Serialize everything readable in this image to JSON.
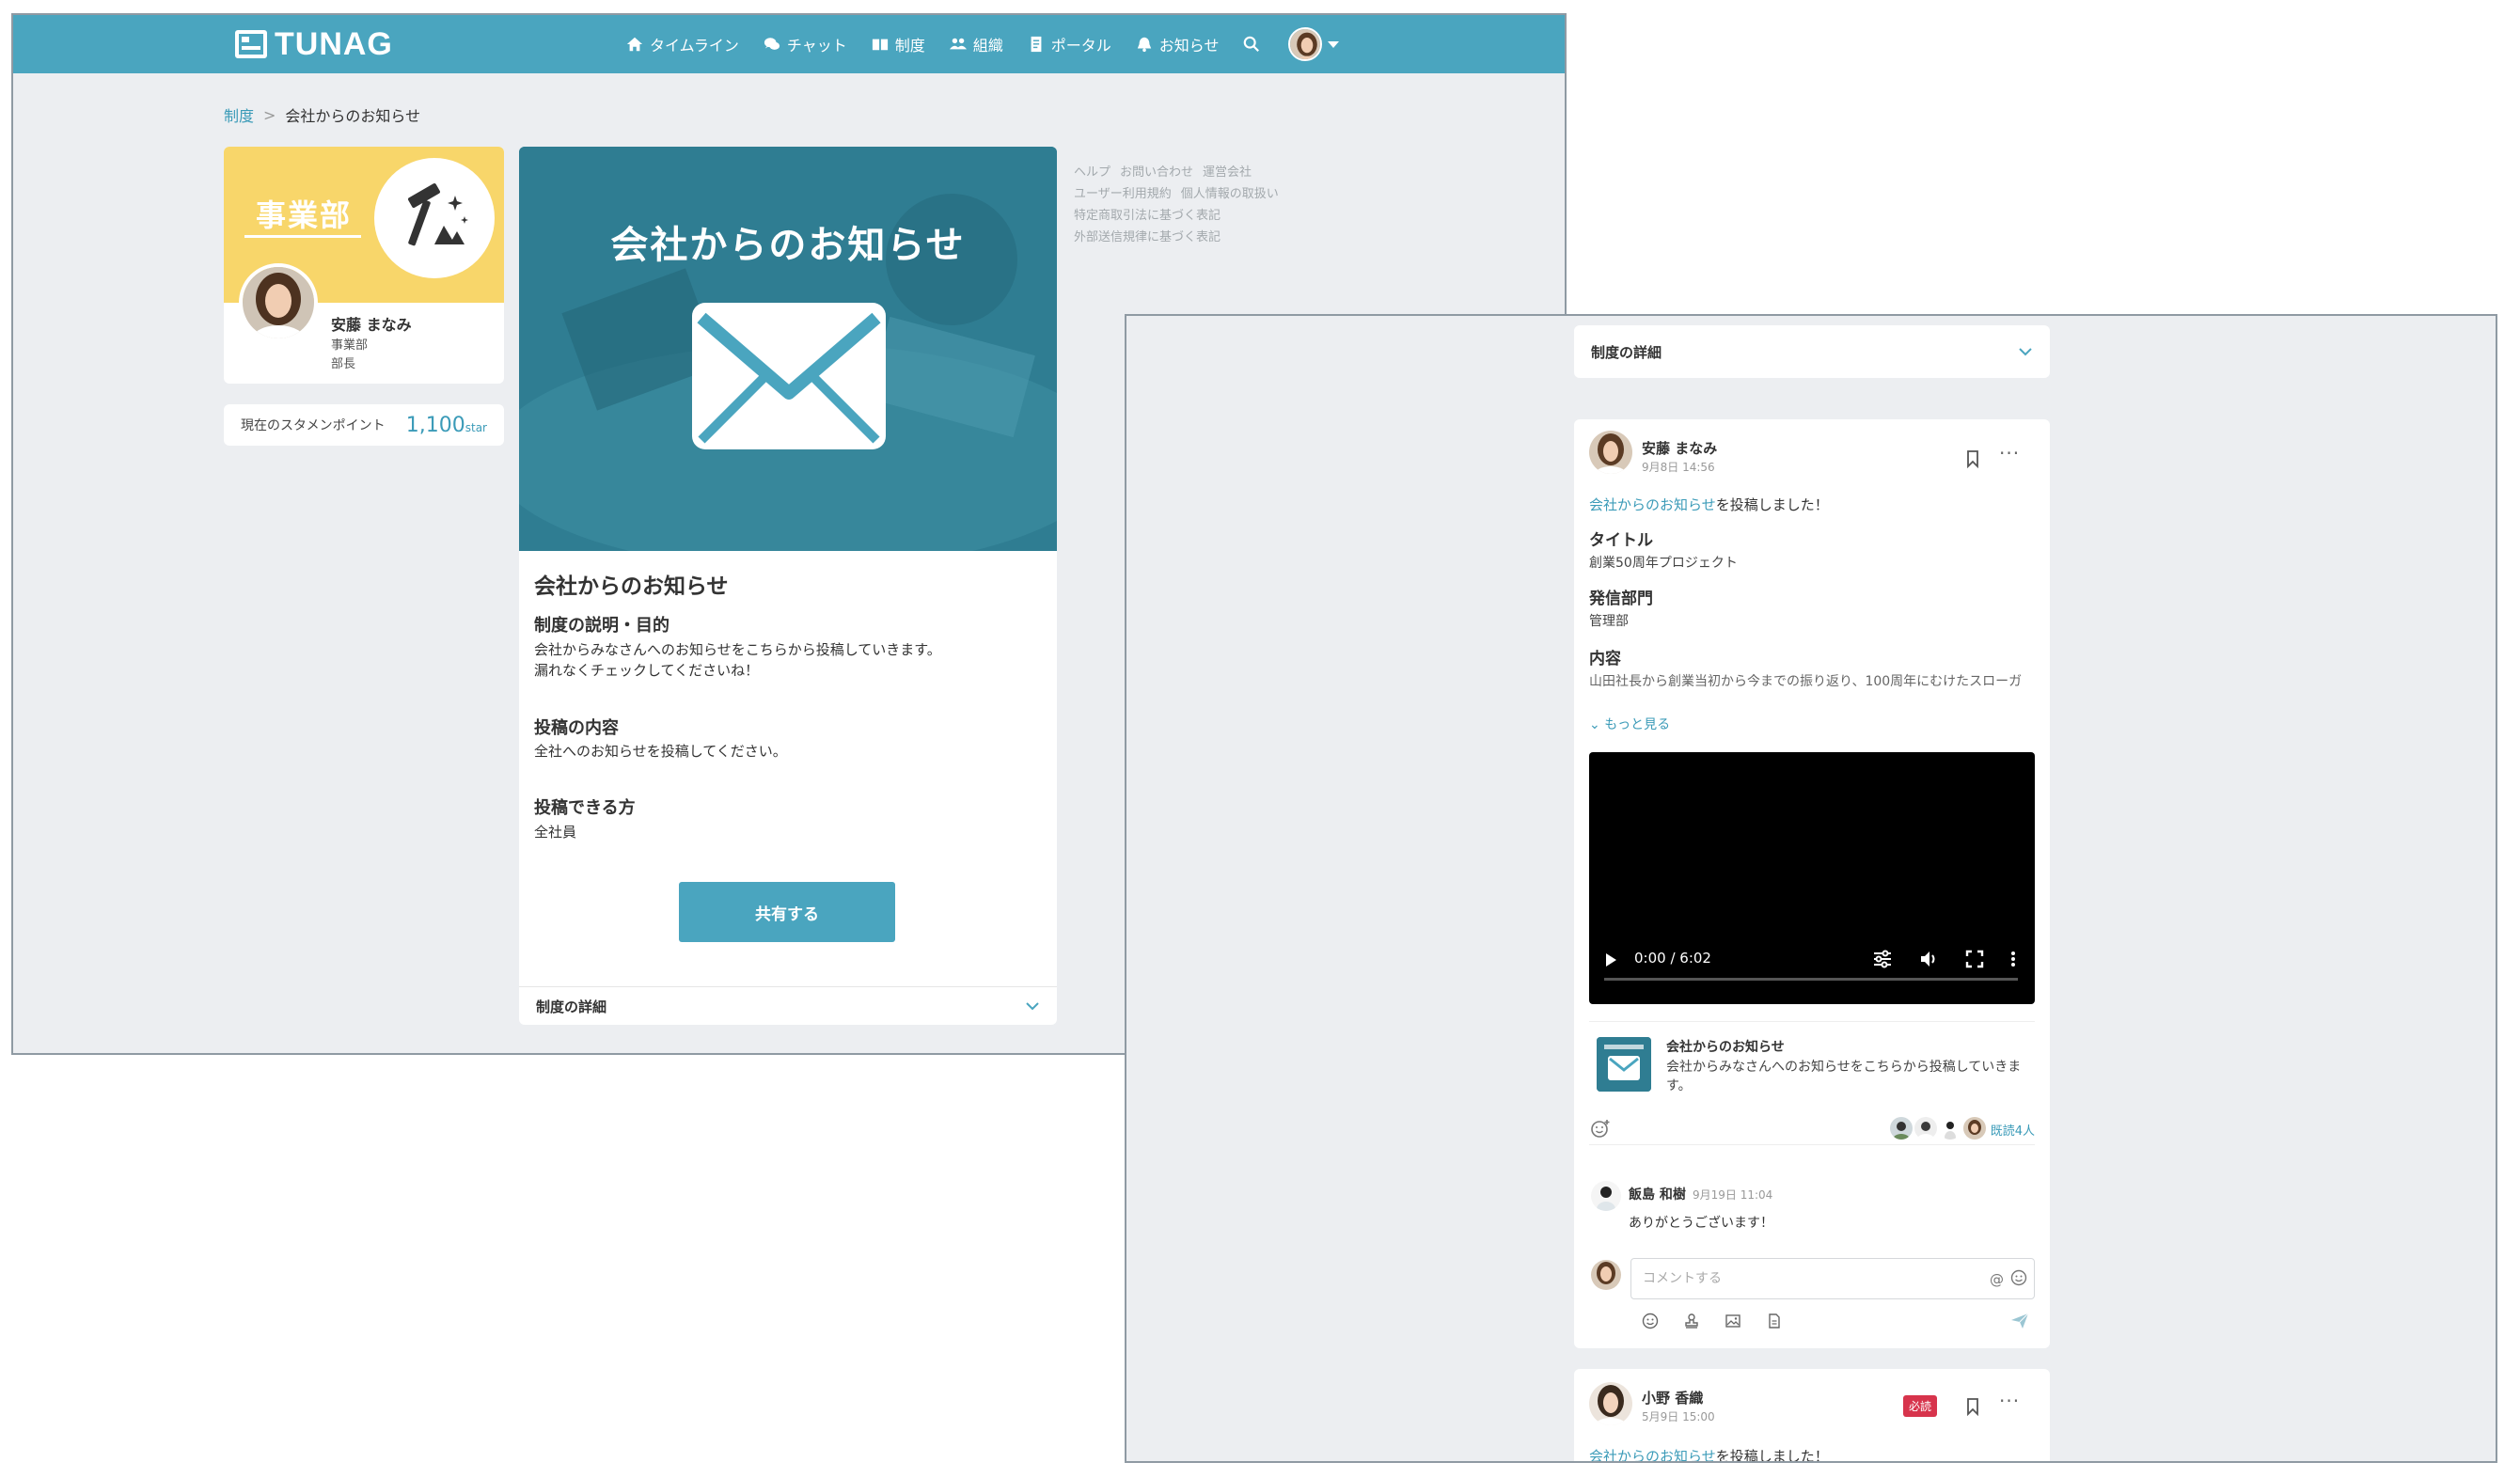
{
  "colors": {
    "brand": "#4aa5bf",
    "link": "#3b9bb8",
    "banner_yellow": "#f8d66a",
    "hero_teal": "#2f7d92",
    "required_red": "#d7344c"
  },
  "app": {
    "logo": "TUNAG"
  },
  "nav": {
    "items": [
      {
        "label": "タイムライン",
        "icon": "home-icon"
      },
      {
        "label": "チャット",
        "icon": "chat-icon"
      },
      {
        "label": "制度",
        "icon": "book-icon"
      },
      {
        "label": "組織",
        "icon": "people-icon"
      },
      {
        "label": "ポータル",
        "icon": "document-icon"
      },
      {
        "label": "お知らせ",
        "icon": "bell-icon"
      }
    ]
  },
  "breadcrumb": {
    "parent": "制度",
    "separator": ">",
    "current": "会社からのお知らせ"
  },
  "profile": {
    "department_banner": "事業部",
    "name": "安藤 まなみ",
    "department": "事業部",
    "role": "部長"
  },
  "points": {
    "label": "現在のスタメンポイント",
    "value": "1,100",
    "unit": "star"
  },
  "system": {
    "hero_title": "会社からのお知らせ",
    "title": "会社からのお知らせ",
    "purpose_heading": "制度の説明・目的",
    "purpose_line1": "会社からみなさんへのお知らせをこちらから投稿していきます。",
    "purpose_line2": "漏れなくチェックしてくださいね！",
    "content_heading": "投稿の内容",
    "content_body": "全社へのお知らせを投稿してください。",
    "who_heading": "投稿できる方",
    "who_body": "全社員",
    "share_button": "共有する",
    "details_label": "制度の詳細"
  },
  "footer": {
    "line1": [
      "ヘルプ",
      "お問い合わせ",
      "運営会社"
    ],
    "line2": [
      "ユーザー利用規約",
      "個人情報の取扱い"
    ],
    "line3": [
      "特定商取引法に基づく表記"
    ],
    "line4": [
      "外部送信規律に基づく表記"
    ]
  },
  "detail_panel": {
    "label": "制度の詳細"
  },
  "post1": {
    "author": "安藤 まなみ",
    "date": "9月8日 14:56",
    "action_link": "会社からのお知らせ",
    "action_suffix": "を投稿しました！",
    "title_label": "タイトル",
    "title_value": "創業50周年プロジェクト",
    "dept_label": "発信部門",
    "dept_value": "管理部",
    "content_label": "内容",
    "content_value": "山田社長から創業当初から今までの振り返り、100周年にむけたスローガ",
    "more_link": "もっと見る",
    "video": {
      "time": "0:00 / 6:02",
      "progress": 0
    },
    "linked": {
      "title": "会社からのお知らせ",
      "description": "会社からみなさんへのお知らせをこちらから投稿していきます。"
    },
    "read_count": "既読4人",
    "comment": {
      "author": "飯島 和樹",
      "date": "9月19日 11:04",
      "text": "ありがとうございます！"
    },
    "composer_placeholder": "コメントする",
    "mention_symbol": "@"
  },
  "post2": {
    "author": "小野 香織",
    "date": "5月9日 15:00",
    "badge": "必読",
    "action_link": "会社からのお知らせ",
    "action_suffix": "を投稿しました！"
  }
}
